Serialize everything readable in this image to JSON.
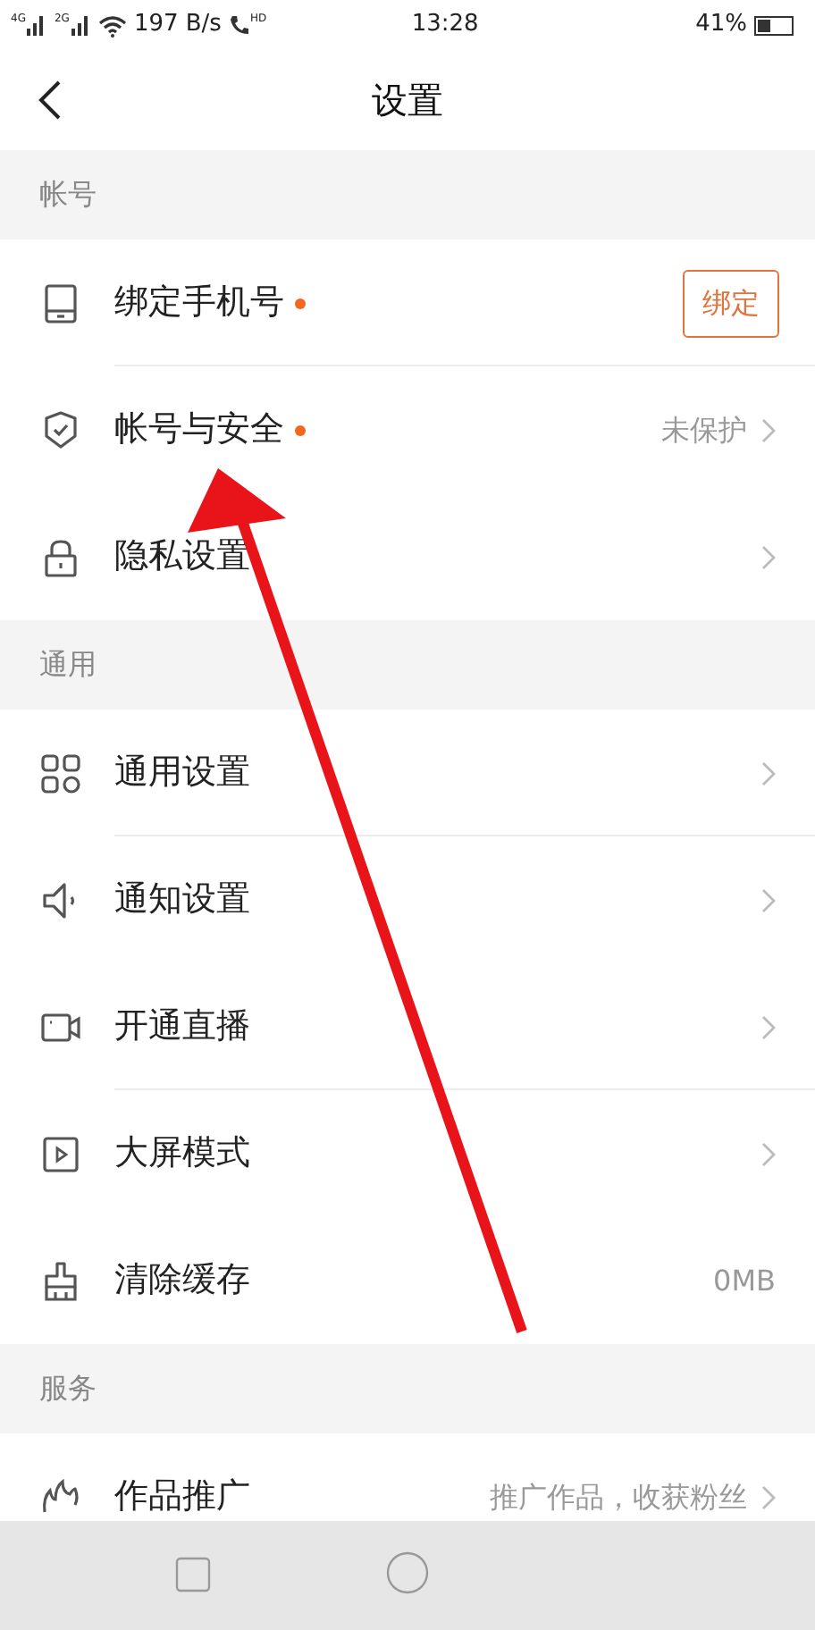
{
  "status_bar": {
    "networks": [
      "4G",
      "2G"
    ],
    "speed": "197 B/s",
    "call_badge": "HD",
    "time": "13:28",
    "battery": "41%"
  },
  "header": {
    "title": "设置"
  },
  "sections": [
    {
      "title": "帐号",
      "rows": [
        {
          "label": "绑定手机号",
          "dot": true,
          "kind": "button",
          "action": "绑定",
          "divider": true
        },
        {
          "label": "帐号与安全",
          "dot": true,
          "kind": "link",
          "value": "未保护",
          "divider": false
        },
        {
          "label": "隐私设置",
          "dot": false,
          "kind": "link",
          "divider": false
        }
      ]
    },
    {
      "title": "通用",
      "rows": [
        {
          "label": "通用设置",
          "dot": false,
          "kind": "link",
          "divider": true
        },
        {
          "label": "通知设置",
          "dot": false,
          "kind": "link",
          "divider": false
        },
        {
          "label": "开通直播",
          "dot": false,
          "kind": "link",
          "divider": true
        },
        {
          "label": "大屏模式",
          "dot": false,
          "kind": "link",
          "divider": false
        },
        {
          "label": "清除缓存",
          "dot": false,
          "kind": "value",
          "value": "0MB",
          "divider": false
        }
      ]
    },
    {
      "title": "服务",
      "rows": [
        {
          "label": "作品推广",
          "dot": false,
          "kind": "link",
          "value": "推广作品，收获粉丝",
          "divider": false
        }
      ]
    }
  ],
  "annotation": {
    "kind": "arrow",
    "color": "#e8141a"
  }
}
